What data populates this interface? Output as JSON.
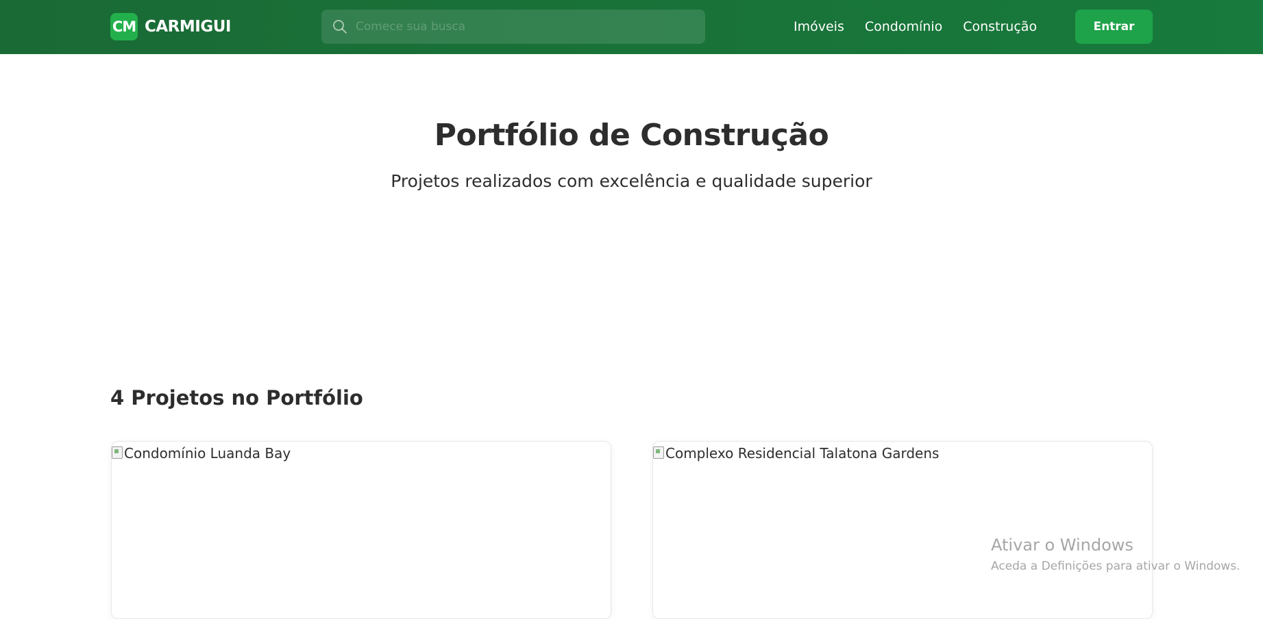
{
  "header": {
    "logo_badge": "CM",
    "logo_text": "CARMIGUI",
    "search_placeholder": "Comece sua busca",
    "nav": [
      {
        "label": "Imóveis"
      },
      {
        "label": "Condomínio"
      },
      {
        "label": "Construção"
      }
    ],
    "login_label": "Entrar"
  },
  "hero": {
    "title": "Portfólio de Construção",
    "subtitle": "Projetos realizados com excelência e qualidade superior"
  },
  "portfolio": {
    "count_heading": "4 Projetos no Portfólio",
    "projects": [
      {
        "alt": "Condomínio Luanda Bay"
      },
      {
        "alt": "Complexo Residencial Talatona Gardens"
      }
    ]
  },
  "os_overlay": {
    "title": "Ativar o Windows",
    "subtitle": "Aceda a Definições para ativar o Windows."
  },
  "colors": {
    "header_bg": "#1a6a35",
    "accent": "#1ea24a",
    "logo_badge": "#23b04c",
    "text": "#2d2d2d"
  },
  "icons": {
    "search": "search-icon",
    "broken_image": "broken-image-icon"
  }
}
